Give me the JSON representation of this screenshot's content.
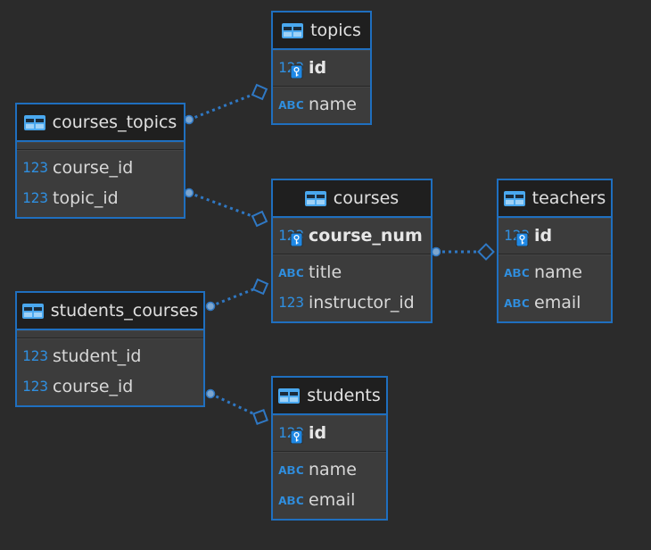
{
  "tables": [
    {
      "name": "topics",
      "sections": [
        [
          {
            "name": "id",
            "type": "123",
            "pk": true
          }
        ],
        [
          {
            "name": "name",
            "type": "ABC",
            "pk": false
          }
        ]
      ]
    },
    {
      "name": "courses_topics",
      "sections": [
        [],
        [
          {
            "name": "course_id",
            "type": "123",
            "pk": false
          },
          {
            "name": "topic_id",
            "type": "123",
            "pk": false
          }
        ]
      ]
    },
    {
      "name": "courses",
      "sections": [
        [
          {
            "name": "course_num",
            "type": "123",
            "pk": true
          }
        ],
        [
          {
            "name": "title",
            "type": "ABC",
            "pk": false
          },
          {
            "name": "instructor_id",
            "type": "123",
            "pk": false
          }
        ]
      ]
    },
    {
      "name": "teachers",
      "sections": [
        [
          {
            "name": "id",
            "type": "123",
            "pk": true
          }
        ],
        [
          {
            "name": "name",
            "type": "ABC",
            "pk": false
          },
          {
            "name": "email",
            "type": "ABC",
            "pk": false
          }
        ]
      ]
    },
    {
      "name": "students_courses",
      "sections": [
        [],
        [
          {
            "name": "student_id",
            "type": "123",
            "pk": false
          },
          {
            "name": "course_id",
            "type": "123",
            "pk": false
          }
        ]
      ]
    },
    {
      "name": "students",
      "sections": [
        [
          {
            "name": "id",
            "type": "123",
            "pk": true
          }
        ],
        [
          {
            "name": "name",
            "type": "ABC",
            "pk": false
          },
          {
            "name": "email",
            "type": "ABC",
            "pk": false
          }
        ]
      ]
    }
  ],
  "relationships": [
    {
      "from": "courses_topics",
      "to": "topics"
    },
    {
      "from": "courses_topics",
      "to": "courses"
    },
    {
      "from": "students_courses",
      "to": "courses"
    },
    {
      "from": "students_courses",
      "to": "students"
    },
    {
      "from": "courses",
      "to": "teachers"
    }
  ],
  "colors": {
    "background": "#2b2b2b",
    "border": "#1f6fbf",
    "header": "#1f1f1f",
    "body": "#3c3c3c",
    "link": "#2f78c4",
    "type_icon": "#2f8fe0"
  }
}
